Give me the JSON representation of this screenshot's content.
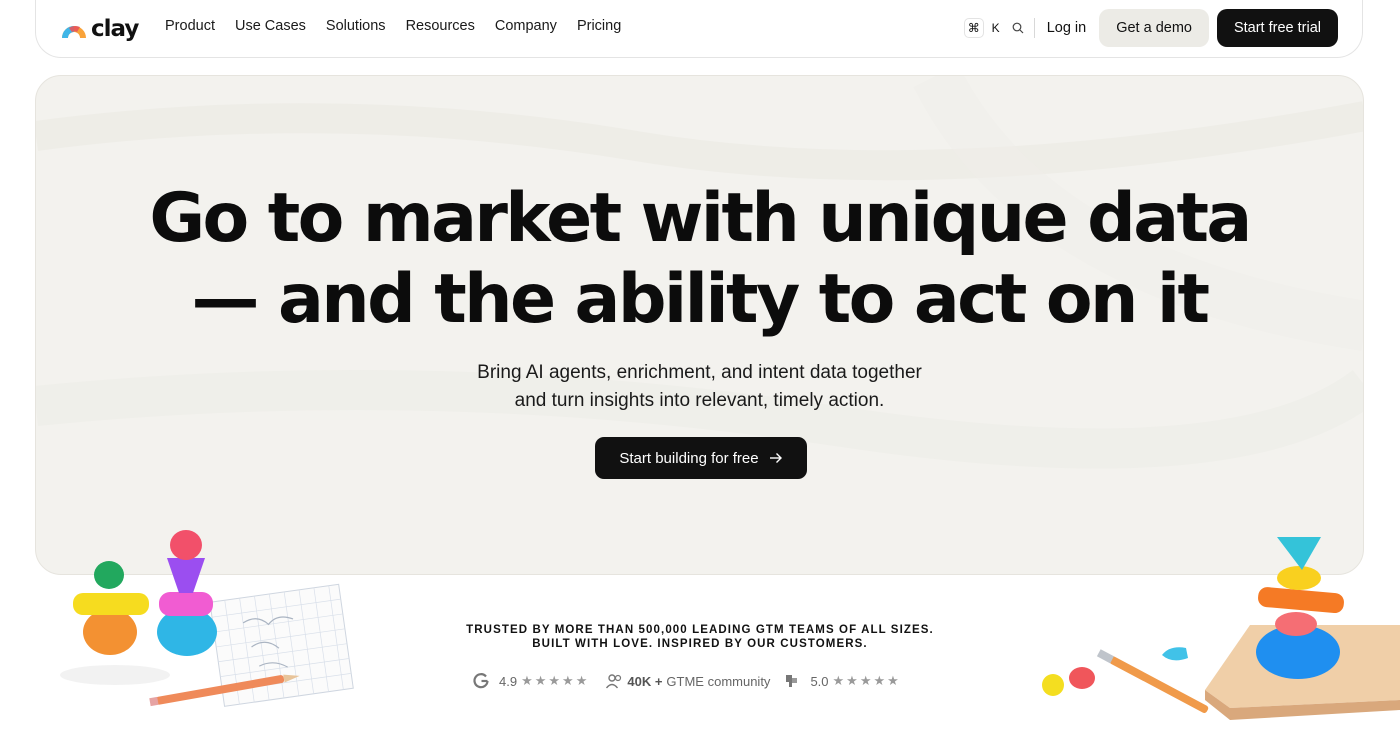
{
  "nav": {
    "logo_text": "clay",
    "menu": [
      "Product",
      "Use Cases",
      "Solutions",
      "Resources",
      "Company",
      "Pricing"
    ],
    "shortcut": [
      "⌘",
      "K"
    ],
    "login": "Log in",
    "demo": "Get a demo",
    "trial": "Start free trial"
  },
  "hero": {
    "headline_line1": "Go to market with unique data",
    "headline_line2": "— and the ability to act on it",
    "sub_line1": "Bring AI agents, enrichment, and intent data together",
    "sub_line2": "and turn insights into relevant, timely action.",
    "cta": "Start building for free"
  },
  "trust": {
    "line1": "TRUSTED BY MORE THAN 500,000 LEADING GTM TEAMS OF ALL SIZES.",
    "line2": "BUILT WITH LOVE. INSPIRED BY OUR CUSTOMERS."
  },
  "ratings": {
    "g2_score": "4.9",
    "community_count": "40K +",
    "community_label": "GTME community",
    "review_score": "5.0",
    "stars": "★★★★★"
  },
  "colors": {
    "hero_bg": "#f3f2ee",
    "primary_button": "#111111",
    "secondary_button": "#ecebe6"
  }
}
